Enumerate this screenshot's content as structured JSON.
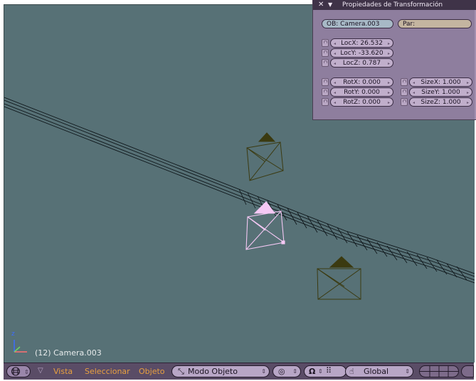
{
  "panel": {
    "title": "Propiedades de Transformación",
    "ob_field": "OB: Camera.003",
    "par_field": "Par:",
    "loc": [
      "LocX: 26.532",
      "LocY: -33.620",
      "LocZ: 0.787"
    ],
    "rot": [
      "RotX: 0.000",
      "RotY: 0.000",
      "RotZ: 0.000"
    ],
    "size": [
      "SizeX: 1.000",
      "SizeY: 1.000",
      "SizeZ: 1.000"
    ]
  },
  "viewport": {
    "object_label": "(12) Camera.003",
    "axis_z": "z"
  },
  "header": {
    "menu": [
      "Vista",
      "Seleccionar",
      "Objeto"
    ],
    "mode": "Modo Objeto",
    "orientation": "Global"
  },
  "colors": {
    "viewport_bg": "#577176",
    "panel_bg": "#9680a4",
    "header_bg": "#5a4c66",
    "menu_text": "#e8a040",
    "camera_wire": "#3b3a10",
    "selected_wire": "#f4c8f4"
  },
  "icons": [
    "grid-view-icon",
    "triangle-menu-icon",
    "mode-arrows-icon",
    "draw-type-icon",
    "pivot-icon",
    "snap-icon",
    "hand-manipulator-icon",
    "layer-buttons-icon",
    "close-icon",
    "collapse-triangle-icon",
    "lock-icon"
  ]
}
